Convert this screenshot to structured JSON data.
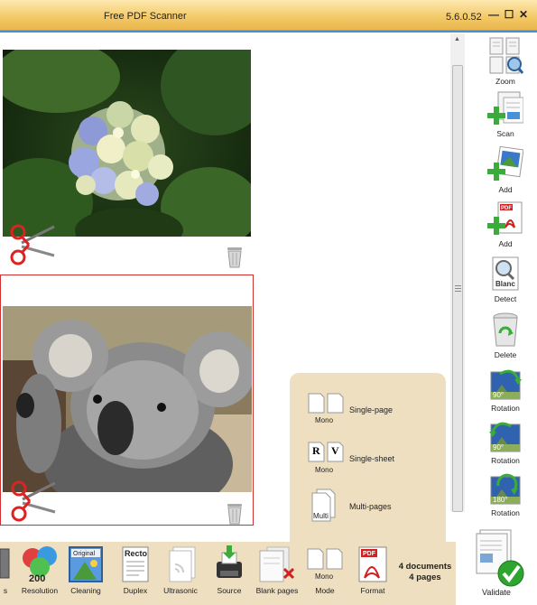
{
  "window": {
    "title": "Free PDF Scanner",
    "version": "5.6.0.52",
    "minimize_glyph": "—",
    "maximize_glyph": "☐",
    "close_glyph": "✕"
  },
  "right_toolbar": [
    {
      "label": "Zoom",
      "icon": "zoom-icon"
    },
    {
      "label": "Scan",
      "icon": "scan-icon"
    },
    {
      "label": "Add",
      "icon": "add-image-icon"
    },
    {
      "label": "Add",
      "icon": "add-pdf-icon"
    },
    {
      "label": "Detect",
      "icon": "detect-blank-icon"
    },
    {
      "label": "Delete",
      "icon": "recycle-bin-icon"
    },
    {
      "label": "Rotation",
      "icon": "rotate-90-right-icon",
      "angle": "90°"
    },
    {
      "label": "Rotation",
      "icon": "rotate-90-left-icon",
      "angle": "90°"
    },
    {
      "label": "Rotation",
      "icon": "rotate-180-icon",
      "angle": "180°"
    }
  ],
  "popup": {
    "items": [
      {
        "label": "Single-page",
        "sublabel": "Mono"
      },
      {
        "label": "Single-sheet",
        "sublabel": "Mono",
        "glyph_left": "R",
        "glyph_right": "V"
      },
      {
        "label": "Multi-pages",
        "sublabel": "Multi"
      }
    ]
  },
  "bottom_toolbar": [
    {
      "label": "s",
      "icon": "partial-icon"
    },
    {
      "label": "Resolution",
      "icon": "resolution-icon",
      "value": "200"
    },
    {
      "label": "Cleaning",
      "icon": "cleaning-icon",
      "badge": "Original"
    },
    {
      "label": "Duplex",
      "icon": "duplex-icon",
      "badge": "Recto"
    },
    {
      "label": "Ultrasonic",
      "icon": "ultrasonic-icon"
    },
    {
      "label": "Source",
      "icon": "scanner-source-icon"
    },
    {
      "label": "Blank pages",
      "icon": "blank-pages-icon"
    },
    {
      "label": "Mode",
      "icon": "mode-icon",
      "sublabel": "Mono"
    },
    {
      "label": "Format",
      "icon": "pdf-format-icon",
      "badge": "PDF"
    }
  ],
  "summary": {
    "documents": "4 documents",
    "pages": "4 pages"
  },
  "validate": {
    "label": "Validate"
  },
  "colors": {
    "titlebar": "#f3c866",
    "panel": "#eedfc0",
    "accent_blue": "#4d8bd6",
    "selection": "#d03030"
  }
}
